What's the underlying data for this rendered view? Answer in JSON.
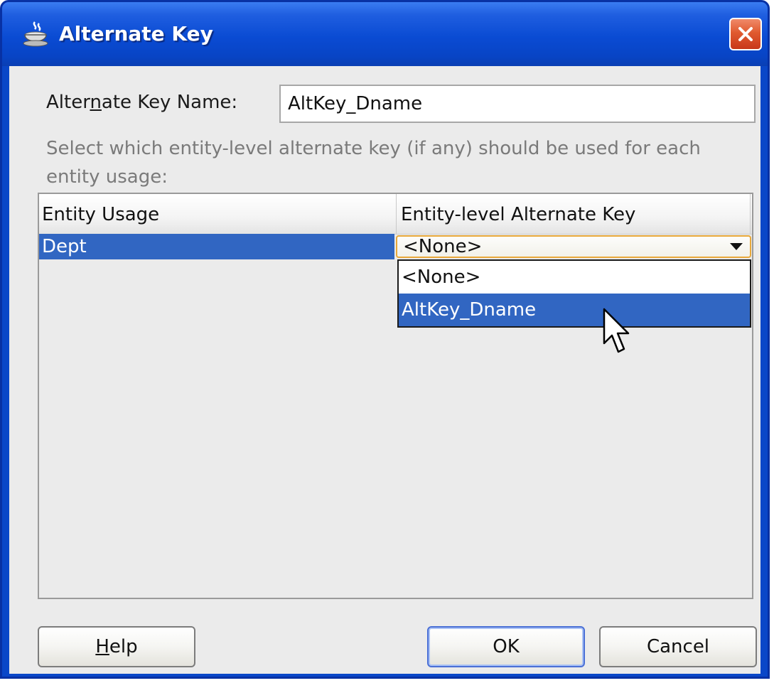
{
  "window": {
    "title": "Alternate Key",
    "close_icon": "close-icon",
    "app_icon": "coffee-cup-icon"
  },
  "form": {
    "name_label_pre": "Alter",
    "name_label_mnemonic": "n",
    "name_label_post": "ate Key Name:",
    "name_value": "AltKey_Dname",
    "description": "Select which entity-level alternate key (if any) should be used for each entity usage:"
  },
  "table": {
    "columns": [
      "Entity Usage",
      "Entity-level Alternate Key"
    ],
    "rows": [
      {
        "entity_usage": "Dept",
        "alternate_key": "<None>"
      }
    ]
  },
  "dropdown": {
    "selected": "<None>",
    "options": [
      "<None>",
      "AltKey_Dname"
    ],
    "highlighted": "AltKey_Dname"
  },
  "buttons": {
    "help_mnemonic": "H",
    "help_rest": "elp",
    "ok": "OK",
    "cancel": "Cancel"
  },
  "colors": {
    "title_bar": "#0a4bd3",
    "selection": "#3166c2",
    "close_button": "#e05a2f",
    "combo_focus_border": "#e8a83a"
  }
}
